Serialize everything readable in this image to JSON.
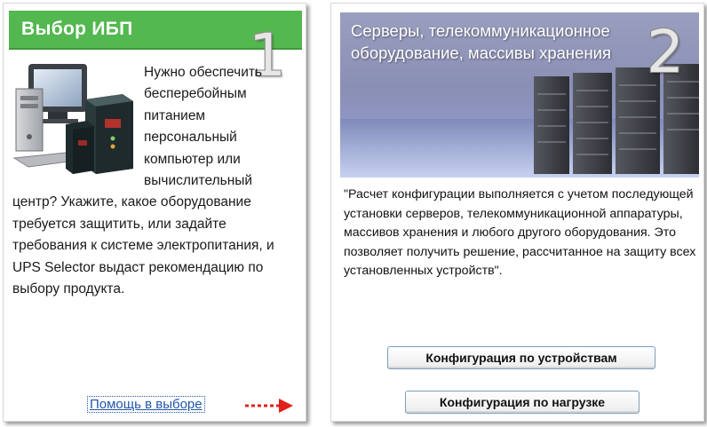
{
  "panel1": {
    "title": "Выбор ИБП",
    "number": "1",
    "text_wrapped": "Нужно обеспечить бесперебойным питанием персональный",
    "text_rest": "компьютер или вычислительный центр? Укажите, какое оборудование требуется защитить, или задайте требования к системе электропитания, и UPS Selector выдаст рекомендацию по выбору продукта.",
    "help_link": "Помощь в выборе",
    "illustration_icon": "computer-and-ups-icon",
    "arrow_icon": "red-arrow-right-icon",
    "header_color": "#53b84f"
  },
  "panel2": {
    "title_line1": "Серверы, телекоммуникационное",
    "title_line2": "оборудование, массивы хранения",
    "number": "2",
    "illustration_icon": "server-racks-icon",
    "text": "\"Расчет конфигурации выполняется с учетом последующей установки серверов, телекоммуникационной аппаратуры, массивов хранения и любого другого оборудования. Это позволяет получить решение, рассчитанное на защиту всех установленных устройств\".",
    "button_devices": "Конфигурация по устройствам",
    "button_load": "Конфигурация по нагрузке"
  }
}
